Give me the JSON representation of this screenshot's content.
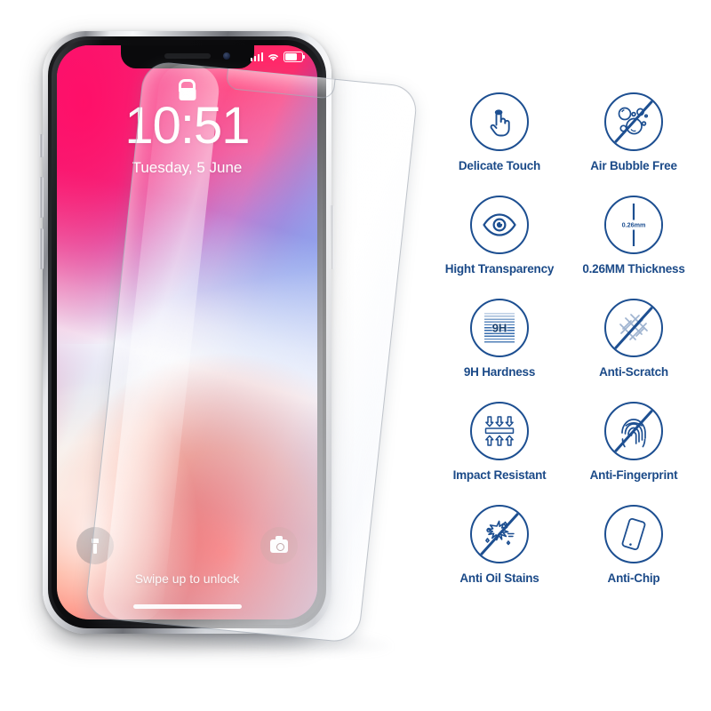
{
  "background_color": "#ffffff",
  "accent_color": "#1d4f91",
  "label_color": "#1b4a88",
  "phone": {
    "device_name": "iPhone X",
    "status_bar": {
      "signal_icon": "signal-bars-icon",
      "wifi_icon": "wifi-icon",
      "battery_icon": "battery-icon"
    },
    "notch": {
      "speaker_icon": "earpiece-speaker-icon",
      "camera_icon": "front-camera-icon"
    },
    "lock_screen": {
      "lock_icon": "lock-closed-icon",
      "time": "10:51",
      "date": "Tuesday, 5 June",
      "swipe_hint": "Swipe up to unlock",
      "flashlight_icon": "flashlight-icon",
      "camera_button_icon": "camera-icon",
      "home_indicator": "home-indicator"
    },
    "side_buttons": {
      "mute_switch": "mute-switch",
      "volume_up": "volume-up-button",
      "volume_down": "volume-down-button",
      "power": "power-button"
    }
  },
  "screen_protector": {
    "name": "tempered-glass-screen-protector",
    "notch_cutout": "notch-cutout"
  },
  "features": [
    {
      "label": "Delicate Touch",
      "icon": "touch-finger-icon",
      "slashed": false
    },
    {
      "label": "Air Bubble Free",
      "icon": "air-bubbles-icon",
      "slashed": true
    },
    {
      "label": "Hight Transparency",
      "icon": "eye-icon",
      "slashed": false
    },
    {
      "label": "0.26MM Thickness",
      "icon": "thickness-caliper-icon",
      "slashed": false,
      "value": "0.26mm"
    },
    {
      "label": "9H Hardness",
      "icon": "hardness-swatch-icon",
      "slashed": false,
      "value": "9H"
    },
    {
      "label": "Anti-Scratch",
      "icon": "scratch-marks-icon",
      "slashed": true
    },
    {
      "label": "Impact Resistant",
      "icon": "impact-arrows-icon",
      "slashed": false
    },
    {
      "label": "Anti-Fingerprint",
      "icon": "fingerprint-icon",
      "slashed": true
    },
    {
      "label": "Anti Oil Stains",
      "icon": "oil-splash-icon",
      "slashed": true
    },
    {
      "label": "Anti-Chip",
      "icon": "phone-outline-icon",
      "slashed": false
    }
  ]
}
